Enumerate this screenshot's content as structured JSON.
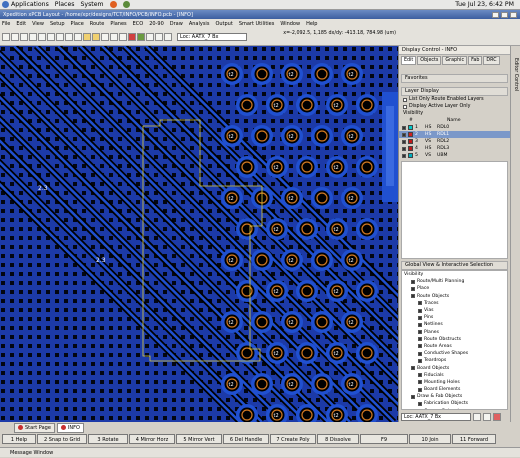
{
  "gnome": {
    "menu": [
      "Applications",
      "Places",
      "System"
    ],
    "time": "Tue Jul 23, 6:42 PM"
  },
  "window": {
    "title": "Xpedition xPCB Layout - /home/xpr/designs/TCT/INFO/PCB/INFO.pcb - [INFO]"
  },
  "menu": [
    "File",
    "Edit",
    "View",
    "Setup",
    "Place",
    "Route",
    "Planes",
    "ECO",
    "20-90",
    "Draw",
    "Analysis",
    "Output",
    "Smart Utilities",
    "Window",
    "Help"
  ],
  "toolbar": {
    "loc_value": "Loc: AATX_7 Bx",
    "coords": "x=-2,092.5, 1,185  dx/dy: -413.18, 784.98  (um)"
  },
  "panel": {
    "title": "Display Control - INFO",
    "tabs": [
      "Edit",
      "Objects",
      "Graphic",
      "Fab",
      "DRC"
    ],
    "favorites": "Favorites",
    "layer_display": "Layer Display",
    "opt1": "List Only Route Enabled Layers",
    "opt2": "Display Active Layer Only",
    "visibility": "Visibility",
    "col_num": "#",
    "col_name": "Name",
    "layers": [
      {
        "num": "1",
        "type": "HS",
        "name": "RDL0",
        "color": "#00c8c8"
      },
      {
        "num": "2",
        "type": "HS",
        "name": "RDL1",
        "color": "#d02020"
      },
      {
        "num": "3",
        "type": "VS",
        "name": "RDL2",
        "color": "#c01818"
      },
      {
        "num": "4",
        "type": "HS",
        "name": "RDL3",
        "color": "#b81a1a"
      },
      {
        "num": "5",
        "type": "VS",
        "name": "UBM",
        "color": "#00b0c0"
      }
    ],
    "global_view": "Global View & Interactive Selection",
    "tree": [
      {
        "label": "Visibility",
        "lvl": 0
      },
      {
        "label": "Route/Multi Planning",
        "lvl": 1
      },
      {
        "label": "Place",
        "lvl": 1
      },
      {
        "label": "Route Objects",
        "lvl": 1
      },
      {
        "label": "Traces",
        "lvl": 2
      },
      {
        "label": "Vias",
        "lvl": 2
      },
      {
        "label": "Pins",
        "lvl": 2
      },
      {
        "label": "Netlines",
        "lvl": 2
      },
      {
        "label": "Planes",
        "lvl": 2
      },
      {
        "label": "Route Obstructs",
        "lvl": 2
      },
      {
        "label": "Route Areas",
        "lvl": 2
      },
      {
        "label": "Conductive Shapes",
        "lvl": 2
      },
      {
        "label": "Teardrops",
        "lvl": 2
      },
      {
        "label": "Board Objects",
        "lvl": 1
      },
      {
        "label": "Fiducials",
        "lvl": 2
      },
      {
        "label": "Mounting Holes",
        "lvl": 2
      },
      {
        "label": "Board Elements",
        "lvl": 2
      },
      {
        "label": "Draw & Fab Objects",
        "lvl": 1
      },
      {
        "label": "Fabrication Objects",
        "lvl": 2
      },
      {
        "label": "Copper Balancing",
        "lvl": 2
      }
    ],
    "bottom_select": "Loc: AATX_7 Bx"
  },
  "vstrip_label": "Editor Control",
  "pagetabs": [
    "Start Page",
    "INFO"
  ],
  "fkeys": [
    "1 Help",
    "2 Snap to Grid",
    "3 Rotate",
    "4 Mirror Horz",
    "5 Mirror Vert",
    "6 Del Handle",
    "7 Create Poly",
    "8 Dissolve",
    "F9",
    "10 Join",
    "11 Forward"
  ],
  "status": "Message Window",
  "canvas": {
    "pad_label": "t2",
    "side_label": "2.3",
    "colors": {
      "bg": "#1c3aa8",
      "trace": "#000000",
      "pad": "#d07820",
      "fill": "#2050d0"
    }
  }
}
